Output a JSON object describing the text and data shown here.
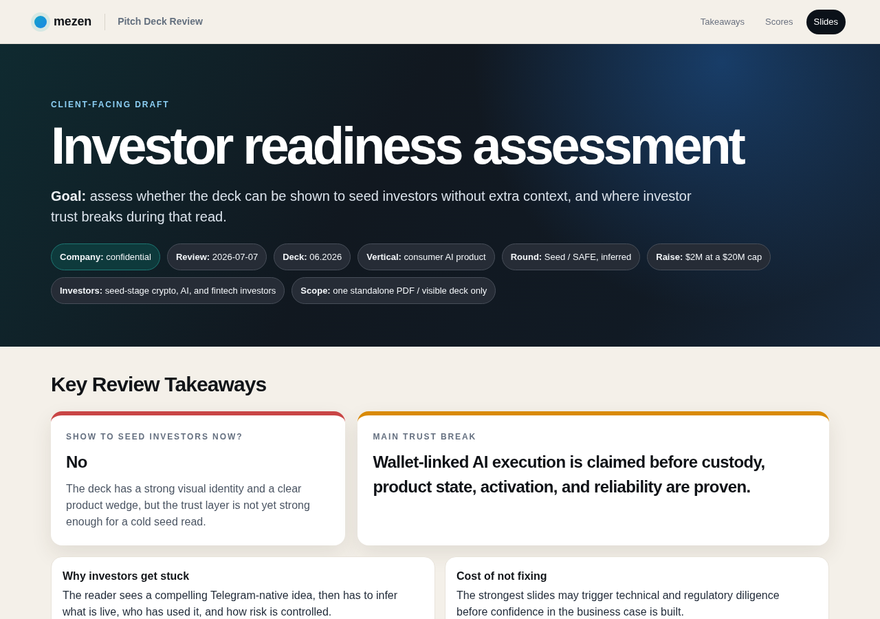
{
  "brand": {
    "name": "mezen",
    "product": "Pitch Deck Review"
  },
  "nav": [
    {
      "label": "Takeaways",
      "selected": false
    },
    {
      "label": "Scores",
      "selected": false
    },
    {
      "label": "Slides",
      "selected": true
    }
  ],
  "hero": {
    "eyebrow": "CLIENT-FACING DRAFT",
    "title": "Investor readiness assessment",
    "goal": "**Goal:** assess whether the deck can be shown to seed investors without extra context, and where investor trust breaks during that read.",
    "chips": [
      {
        "text": "**Company:** confidential",
        "highlighted": true
      },
      {
        "text": "**Review:** 2026-07-07",
        "highlighted": false
      },
      {
        "text": "**Deck:** 06.2026",
        "highlighted": false
      },
      {
        "text": "**Vertical:** consumer AI product",
        "highlighted": false
      },
      {
        "text": "**Round:** Seed / SAFE, inferred",
        "highlighted": false
      },
      {
        "text": "**Raise:** $2M at a $20M cap",
        "highlighted": false
      },
      {
        "text": "**Investors:** seed-stage crypto, AI, and fintech investors",
        "highlighted": false
      },
      {
        "text": "**Scope:** one standalone PDF / visible deck only",
        "highlighted": false
      }
    ]
  },
  "takeaways": {
    "title": "Key Review Takeaways",
    "verdicts": [
      {
        "eyebrow": "SHOW TO SEED INVESTORS NOW?",
        "headline": "No",
        "body": "The deck has a strong visual identity and a clear product wedge, but the trust layer is not yet strong enough for a cold seed read.",
        "color": "#c94545"
      },
      {
        "eyebrow": "MAIN TRUST BREAK",
        "headline": "Wallet-linked AI execution is claimed before custody, product state, activation, and reliability are proven.",
        "color": "#d98a06"
      }
    ],
    "details": [
      {
        "title": "Why investors get stuck",
        "body": "The reader sees a compelling Telegram-native idea, then has to infer what is live, who has used it, and how risk is controlled."
      },
      {
        "title": "Cost of not fixing",
        "body": "The strongest slides may trigger technical and regulatory diligence before confidence in the business case is built."
      }
    ]
  }
}
